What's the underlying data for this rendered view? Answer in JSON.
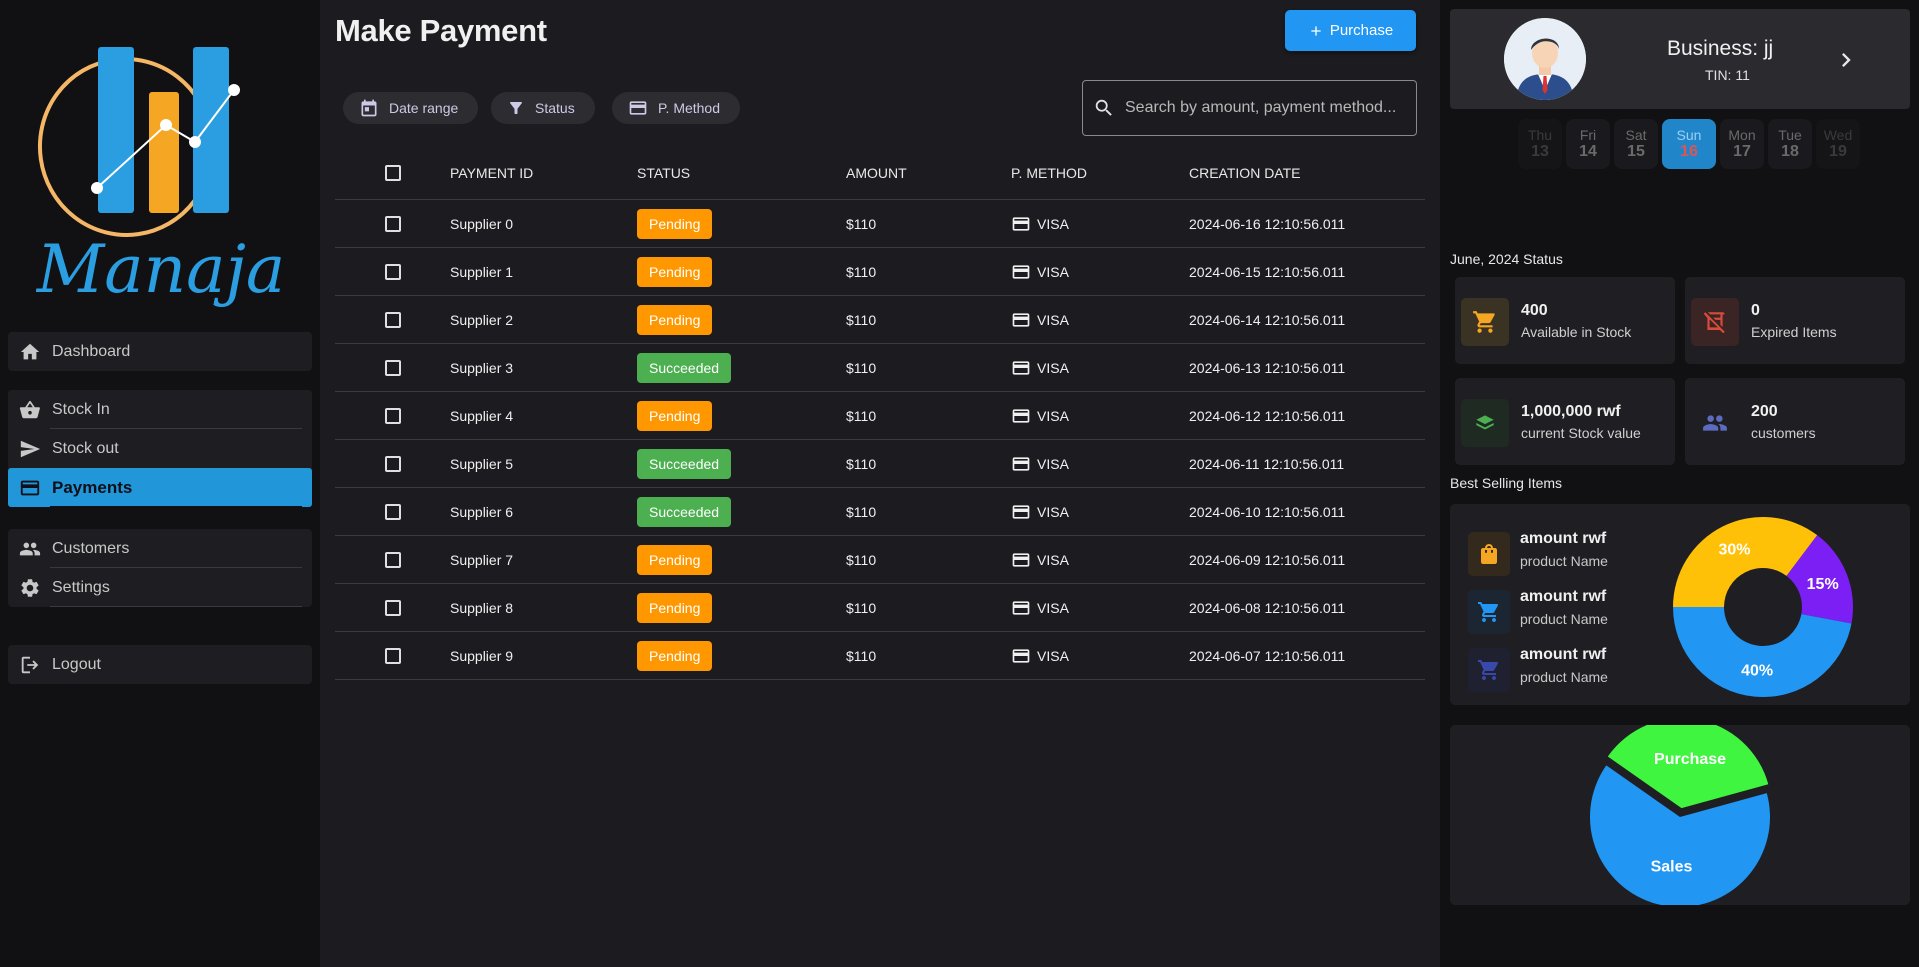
{
  "brand": {
    "logo_text": "Manaja",
    "colors": {
      "blue": "#2196d8",
      "orange": "#f5a623"
    }
  },
  "sidebar": {
    "items": [
      {
        "label": "Dashboard",
        "icon": "home-icon"
      },
      {
        "label": "Stock In",
        "icon": "basket-icon"
      },
      {
        "label": "Stock out",
        "icon": "send-icon"
      },
      {
        "label": "Payments",
        "icon": "credit-card-icon",
        "active": true
      },
      {
        "label": "Customers",
        "icon": "people-icon"
      },
      {
        "label": "Settings",
        "icon": "gear-icon"
      },
      {
        "label": "Logout",
        "icon": "logout-icon"
      }
    ]
  },
  "main": {
    "title": "Make Payment",
    "purchase_button": "Purchase",
    "filters": {
      "date_range": "Date range",
      "status": "Status",
      "method": "P. Method"
    },
    "search_placeholder": "Search by amount, payment method...",
    "table": {
      "headers": {
        "id": "PAYMENT ID",
        "status": "STATUS",
        "amount": "AMOUNT",
        "method": "P. METHOD",
        "date": "CREATION DATE"
      },
      "rows": [
        {
          "id": "Supplier 0",
          "status": "Pending",
          "amount": "$110",
          "method": "VISA",
          "date": "2024-06-16 12:10:56.011"
        },
        {
          "id": "Supplier 1",
          "status": "Pending",
          "amount": "$110",
          "method": "VISA",
          "date": "2024-06-15 12:10:56.011"
        },
        {
          "id": "Supplier 2",
          "status": "Pending",
          "amount": "$110",
          "method": "VISA",
          "date": "2024-06-14 12:10:56.011"
        },
        {
          "id": "Supplier 3",
          "status": "Succeeded",
          "amount": "$110",
          "method": "VISA",
          "date": "2024-06-13 12:10:56.011"
        },
        {
          "id": "Supplier 4",
          "status": "Pending",
          "amount": "$110",
          "method": "VISA",
          "date": "2024-06-12 12:10:56.011"
        },
        {
          "id": "Supplier 5",
          "status": "Succeeded",
          "amount": "$110",
          "method": "VISA",
          "date": "2024-06-11 12:10:56.011"
        },
        {
          "id": "Supplier 6",
          "status": "Succeeded",
          "amount": "$110",
          "method": "VISA",
          "date": "2024-06-10 12:10:56.011"
        },
        {
          "id": "Supplier 7",
          "status": "Pending",
          "amount": "$110",
          "method": "VISA",
          "date": "2024-06-09 12:10:56.011"
        },
        {
          "id": "Supplier 8",
          "status": "Pending",
          "amount": "$110",
          "method": "VISA",
          "date": "2024-06-08 12:10:56.011"
        },
        {
          "id": "Supplier 9",
          "status": "Pending",
          "amount": "$110",
          "method": "VISA",
          "date": "2024-06-07 12:10:56.011"
        }
      ]
    }
  },
  "right": {
    "business_name": "Business: jj",
    "tin": "TIN: 11",
    "days": [
      {
        "day": "Thu",
        "num": "13"
      },
      {
        "day": "Fri",
        "num": "14"
      },
      {
        "day": "Sat",
        "num": "15"
      },
      {
        "day": "Sun",
        "num": "16",
        "active": true
      },
      {
        "day": "Mon",
        "num": "17"
      },
      {
        "day": "Tue",
        "num": "18"
      },
      {
        "day": "Wed",
        "num": "19"
      }
    ],
    "status_title": "June, 2024 Status",
    "stats": [
      {
        "value": "400",
        "label": "Available in Stock",
        "icon": "cart-icon",
        "color": "#f5a623"
      },
      {
        "value": "0",
        "label": "Expired Items",
        "icon": "off-icon",
        "color": "#d84c3c"
      },
      {
        "value": "1,000,000 rwf",
        "label": "current Stock value",
        "icon": "money-stack-icon",
        "color": "#4caf50"
      },
      {
        "value": "200",
        "label": "customers",
        "icon": "people-icon",
        "color": "#5c6bc0"
      }
    ],
    "best_title": "Best Selling Items",
    "best_items": [
      {
        "amount": "amount rwf",
        "name": "product Name",
        "icon": "bag-icon",
        "color": "#f5a623"
      },
      {
        "amount": "amount rwf",
        "name": "product Name",
        "icon": "cart-icon",
        "color": "#2196f3"
      },
      {
        "amount": "amount rwf",
        "name": "product Name",
        "icon": "cart-icon",
        "color": "#3949ab"
      }
    ]
  },
  "chart_data": [
    {
      "type": "pie",
      "donut": true,
      "slices": [
        {
          "label": "30%",
          "value": 30,
          "color": "#ffc107"
        },
        {
          "label": "15%",
          "value": 15,
          "color": "#7c1ff5"
        },
        {
          "label": "40%",
          "value": 40,
          "color": "#2196f3"
        }
      ]
    },
    {
      "type": "pie",
      "slices": [
        {
          "label": "Purchase",
          "value": 36,
          "color": "#3ff53f"
        },
        {
          "label": "Sales",
          "value": 64,
          "color": "#2196f3"
        }
      ]
    }
  ]
}
